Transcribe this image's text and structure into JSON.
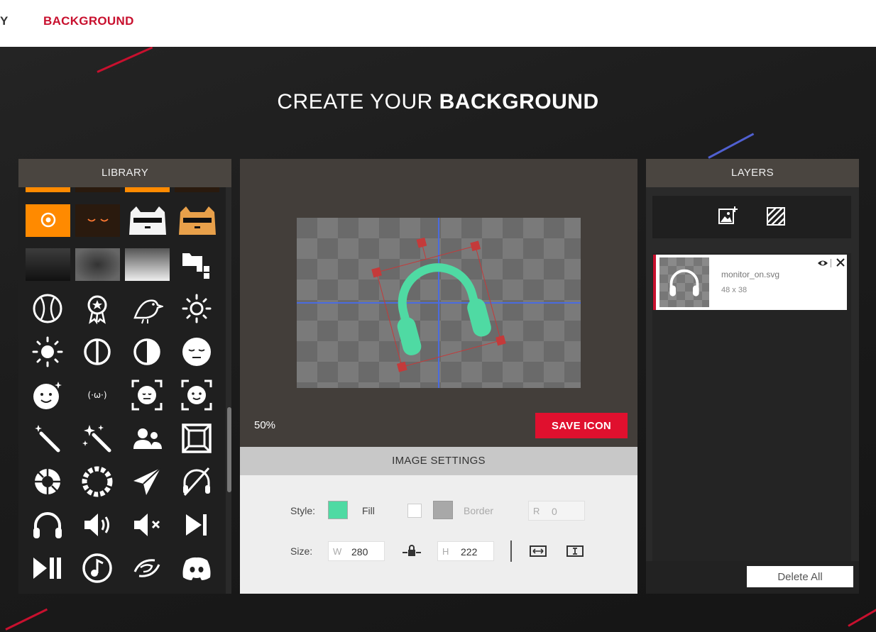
{
  "nav": {
    "partial_tab": "Y",
    "active_tab": "BACKGROUND"
  },
  "headline": {
    "light": "CREATE YOUR ",
    "bold": "BACKGROUND"
  },
  "library": {
    "title": "LIBRARY",
    "icons": [
      "baseball-icon",
      "award-ribbon-icon",
      "bird-icon",
      "sun-outline-icon",
      "sun-filled-icon",
      "half-circle-outline-icon",
      "contrast-icon",
      "sleepy-face-icon",
      "sparkle-face-icon",
      "kaomoji-icon",
      "face-frame-neutral-icon",
      "face-frame-smile-icon",
      "magic-wand-icon",
      "magic-wand-sparkles-icon",
      "users-icon",
      "frame-icon",
      "loading-ring-icon",
      "loading-dots-icon",
      "paper-plane-icon",
      "no-headphones-icon",
      "headphones-icon",
      "volume-icon",
      "mute-icon",
      "skip-next-icon",
      "play-pause-icon",
      "music-note-icon",
      "vortex-icon",
      "discord-icon"
    ],
    "kaomoji_text": "(·ω·)"
  },
  "canvas": {
    "zoom": "50%",
    "save_label": "SAVE ICON",
    "icon_color": "#4fdaa3"
  },
  "settings": {
    "title": "IMAGE SETTINGS",
    "style_label": "Style:",
    "fill_label": "Fill",
    "fill_color": "#4fdaa3",
    "border_label": "Border",
    "radius_prefix": "R",
    "radius_value": "0",
    "size_label": "Size:",
    "width_prefix": "W",
    "width_value": "280",
    "height_prefix": "H",
    "height_value": "222"
  },
  "layers": {
    "title": "LAYERS",
    "items": [
      {
        "name": "monitor_on.svg",
        "dims": "48 x 38"
      }
    ],
    "delete_all_label": "Delete All"
  }
}
